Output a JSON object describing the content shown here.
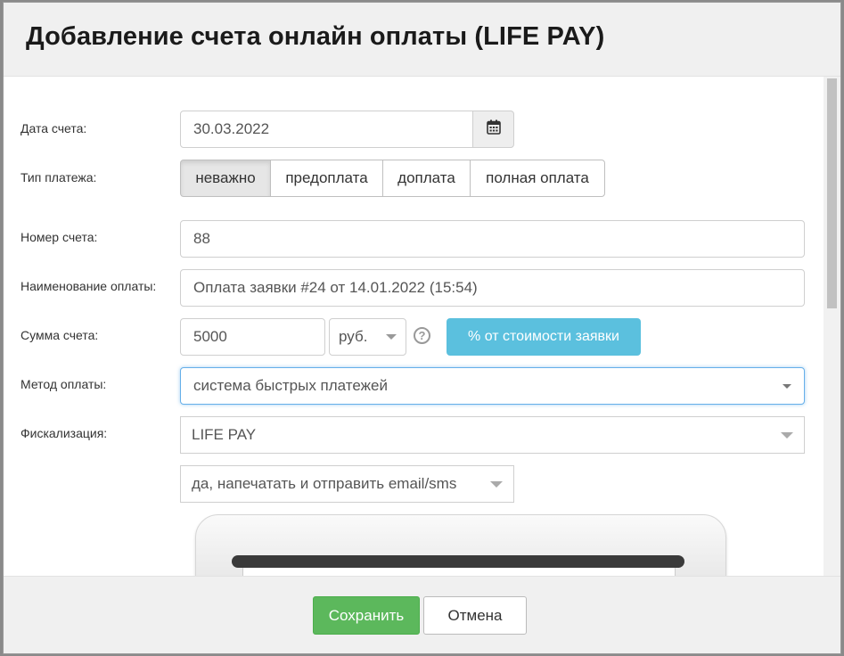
{
  "dialog": {
    "title": "Добавление счета онлайн оплаты (LIFE PAY)"
  },
  "form": {
    "invoice_date": {
      "label": "Дата счета:",
      "value": "30.03.2022",
      "icon": "calendar-icon"
    },
    "payment_type": {
      "label": "Тип платежа:",
      "options": [
        "неважно",
        "предоплата",
        "доплата",
        "полная оплата"
      ],
      "selected": "неважно"
    },
    "invoice_number": {
      "label": "Номер счета:",
      "value": "88"
    },
    "payment_name": {
      "label": "Наименование оплаты:",
      "value": "Оплата заявки #24 от 14.01.2022 (15:54)"
    },
    "amount": {
      "label": "Сумма счета:",
      "value": "5000",
      "currency": "руб.",
      "help_icon": "?",
      "percent_button": "% от стоимости заявки"
    },
    "payment_method": {
      "label": "Метод оплаты:",
      "value": "система быстрых платежей"
    },
    "fiscalization": {
      "label": "Фискализация:",
      "provider": "LIFE PAY",
      "receipt_option": "да, напечатать и отправить email/sms"
    }
  },
  "footer": {
    "save_label": "Сохранить",
    "cancel_label": "Отмена"
  },
  "colors": {
    "save": "#5cb85c",
    "info": "#5bc0de",
    "header_bg": "#f0f0f0"
  }
}
